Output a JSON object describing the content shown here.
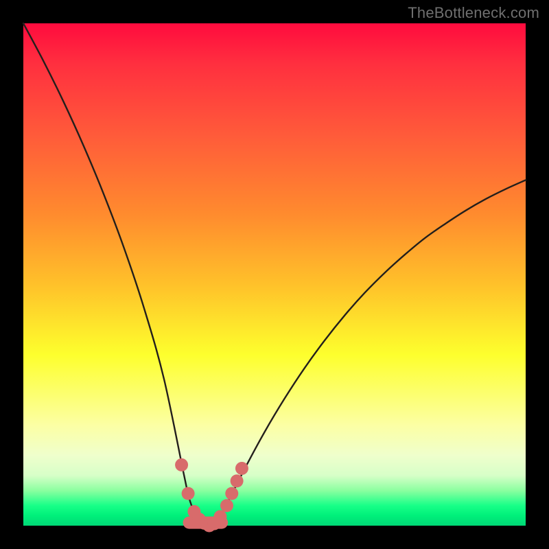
{
  "watermark": "TheBottleneck.com",
  "colors": {
    "frame": "#000000",
    "curve": "#231f1c",
    "marker_fill": "#d86b6b",
    "marker_stroke": "#b85252"
  },
  "chart_data": {
    "type": "line",
    "title": "",
    "xlabel": "",
    "ylabel": "",
    "xlim": [
      0,
      100
    ],
    "ylim": [
      0,
      100
    ],
    "grid": false,
    "legend": false,
    "x": [
      0,
      4,
      8,
      12,
      16,
      20,
      24,
      28,
      32,
      33,
      34,
      35,
      36,
      37,
      38,
      39,
      40,
      44,
      48,
      52,
      56,
      60,
      64,
      68,
      72,
      76,
      80,
      84,
      88,
      92,
      96,
      100
    ],
    "y": [
      100,
      92.5,
      84.4,
      75.6,
      66.0,
      55.4,
      43.4,
      29.2,
      10.0,
      5.5,
      2.8,
      1.3,
      0.5,
      0.0,
      0.4,
      1.5,
      3.3,
      11.2,
      18.6,
      25.3,
      31.4,
      36.9,
      41.9,
      46.4,
      50.4,
      54.0,
      57.3,
      60.1,
      62.7,
      65.0,
      67.0,
      68.8
    ],
    "markers": {
      "x": [
        31.5,
        32.8,
        34.0,
        35.0,
        36.0,
        37.0,
        38.0,
        39.2,
        40.5,
        41.5,
        42.5,
        43.5
      ],
      "y": [
        12.1,
        6.4,
        2.8,
        1.3,
        0.5,
        0.0,
        0.4,
        1.8,
        4.0,
        6.4,
        8.9,
        11.4
      ]
    },
    "marker_bar": {
      "x_start": 33.0,
      "x_end": 39.5,
      "y": 0.6
    }
  }
}
